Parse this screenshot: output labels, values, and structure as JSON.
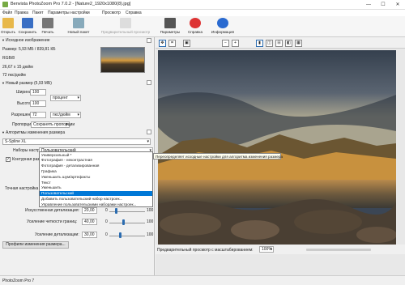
{
  "window": {
    "title": "Benvista PhotoZoom Pro 7.0.2 - [Nature2_1920x1080(8).jpg]",
    "minimize": "—",
    "maximize": "☐",
    "close": "✕"
  },
  "menu": [
    "Файл",
    "Правка",
    "Пакет",
    "Параметры настройки",
    "Просмотр",
    "Справка"
  ],
  "toolbar": {
    "open": "Открыть",
    "save": "Сохранить",
    "print": "Печать",
    "new_batch": "Новый пакет",
    "preview": "Предварительный просмотр",
    "parameters": "Параметры",
    "help": "Справка",
    "info": "Информация"
  },
  "source": {
    "header": "Исходное изображение",
    "size": "Размер: 5,93 МБ / 839,81 КБ",
    "mode": "RGB/8",
    "dimensions": "26,67 x 15 дюйм",
    "resolution": "72 пкс/дюйм"
  },
  "new_size": {
    "header": "Новый размер (5,93 МБ)",
    "width_label": "Ширина:",
    "width_value": "100",
    "height_label": "Высота:",
    "height_value": "100",
    "unit": "процент",
    "resolution_label": "Разрешение:",
    "resolution_value": "72",
    "resolution_unit": "пкс/дюйм",
    "proportions_label": "Пропорции:",
    "proportions_value": "Сохранять пропорции"
  },
  "algorithms": {
    "header": "Алгоритмы изменения размера",
    "method": "S-Spline XL",
    "presets_label": "Наборы настроек:",
    "presets_value": "Пользовательский",
    "contour_label": "Контурная разр",
    "detail_point_label": "Точная настройка",
    "dropdown_items": [
      "Универсальный *",
      "Фотография - неконтрастная",
      "Фотография - детализированная",
      "Графика",
      "Уменьшить шум/артефакты",
      "Текст",
      "Уменьшить",
      "Пользовательский",
      "Добавить пользовательский набор настроек...",
      "Управление пользовательскими наборами настроек..."
    ],
    "tooltip": "Переопределяет исходные настройки для алгоритма изменения размера",
    "artificial_detail_label": "Искусственная детализация:",
    "artificial_detail_value": "20,00",
    "edge_sharpness_label": "Усиление четкости границ:",
    "edge_sharpness_value": "40,00",
    "detail_boost_label": "Усиление детализации:",
    "detail_boost_value": "30,00",
    "slider_min": "0",
    "slider_max": "100",
    "edge_fraction": 0.4,
    "detail_fraction": 0.3,
    "artificial_fraction": 0.2,
    "profiles_button": "Профили изменения размера..."
  },
  "preview": {
    "label": "Предварительный просмотр с масштабированием:",
    "zoom": "100%"
  },
  "status": {
    "app": "PhotoZoom Pro 7"
  }
}
